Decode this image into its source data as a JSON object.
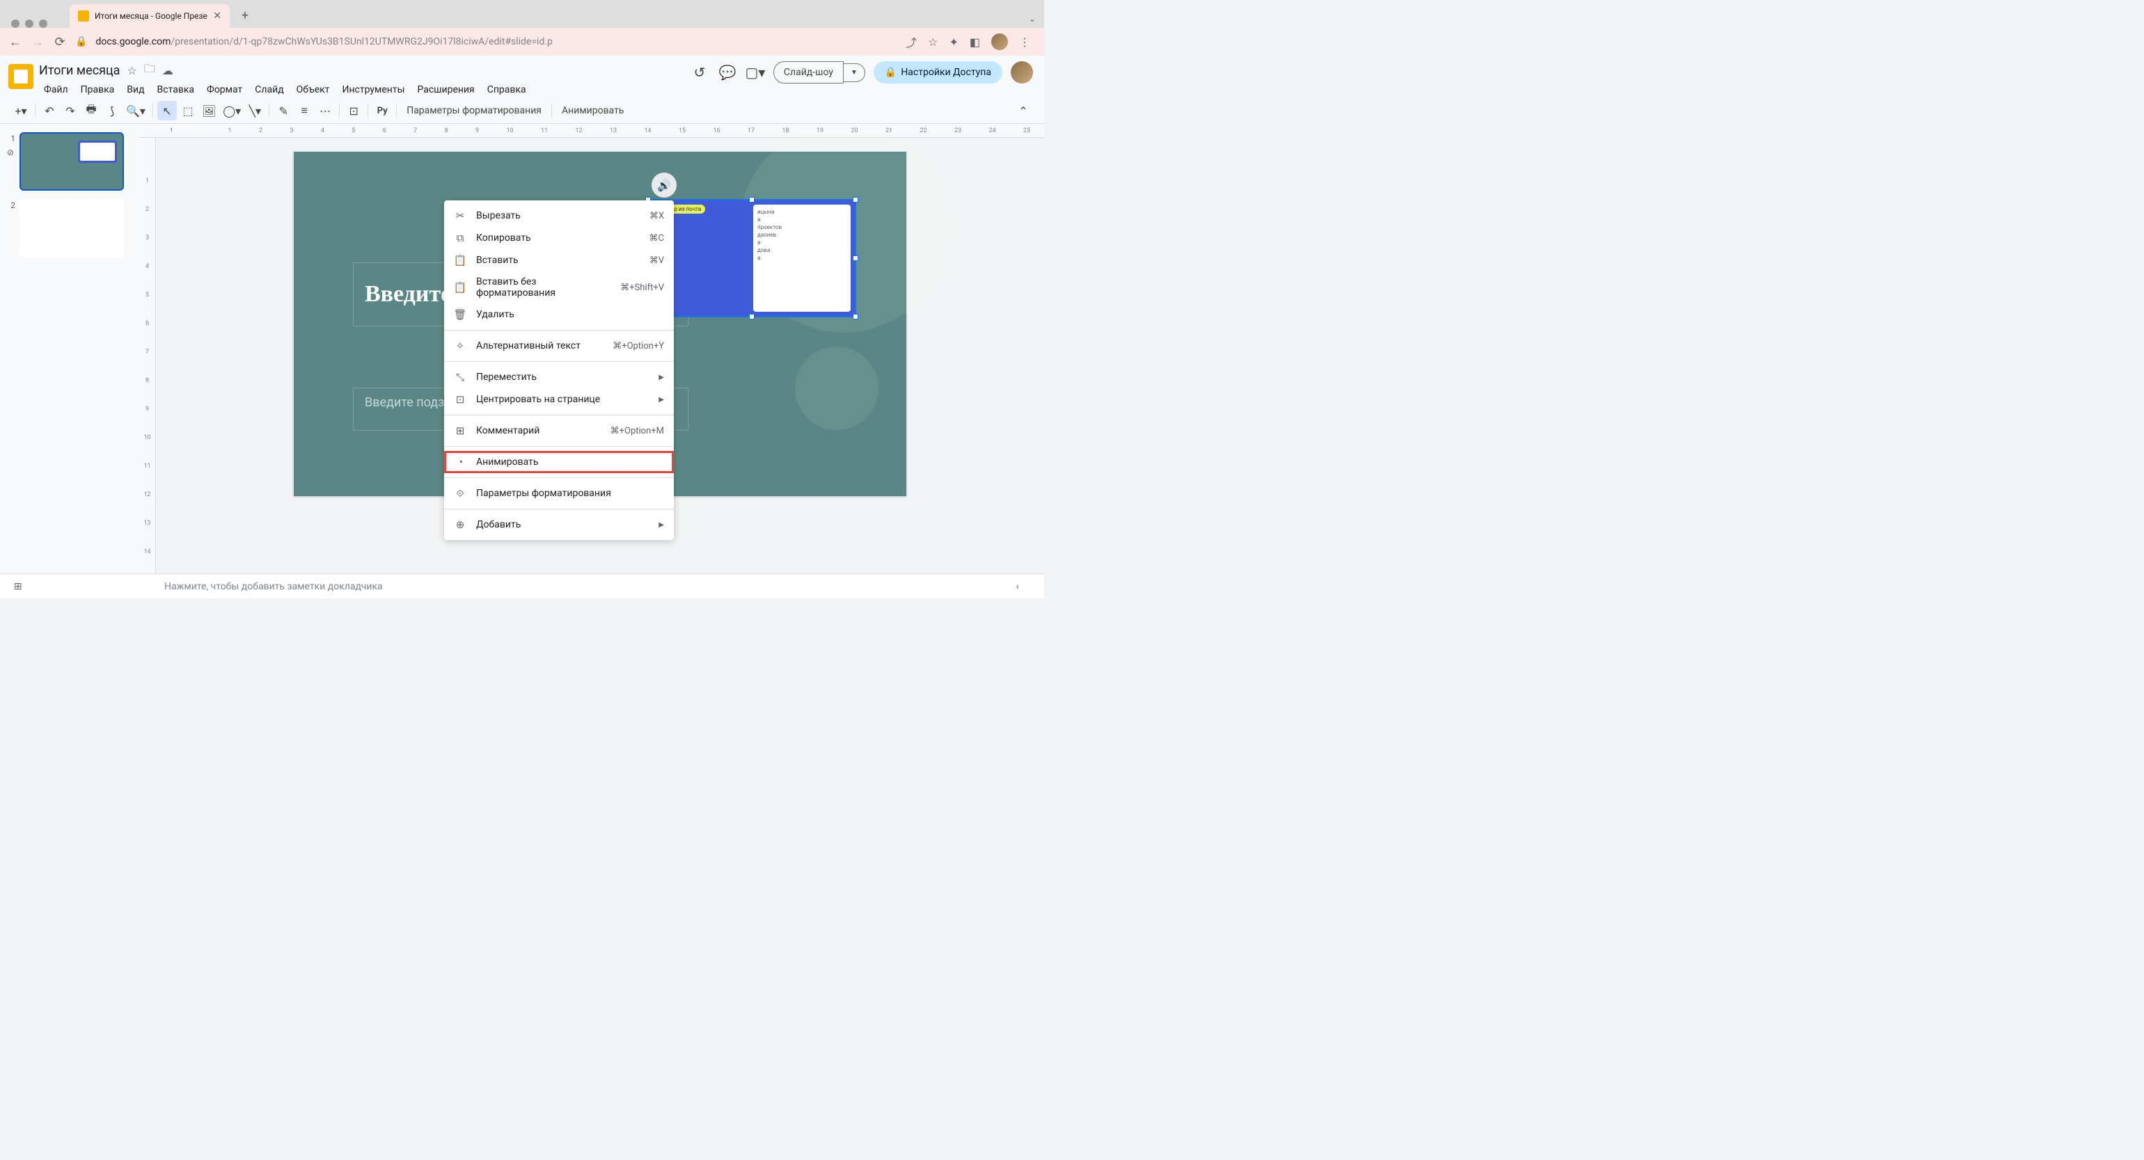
{
  "browser": {
    "tab_title": "Итоги месяца - Google Презе",
    "url_domain": "docs.google.com",
    "url_path": "/presentation/d/1-qp78zwChWsYUs3B1SUnl12UTMWRG2J9Oi17l8iciwA/edit#slide=id.p"
  },
  "doc": {
    "title": "Итоги месяца"
  },
  "menus": [
    "Файл",
    "Правка",
    "Вид",
    "Вставка",
    "Формат",
    "Слайд",
    "Объект",
    "Инструменты",
    "Расширения",
    "Справка"
  ],
  "header_buttons": {
    "slideshow": "Слайд-шоу",
    "share": "Настройки Доступа"
  },
  "toolbar": {
    "format_options": "Параметры форматирования",
    "animate": "Анимировать",
    "py": "Py"
  },
  "ruler_h": [
    "1",
    "",
    "1",
    "2",
    "3",
    "4",
    "5",
    "6",
    "7",
    "8",
    "9",
    "10",
    "11",
    "12",
    "13",
    "14",
    "15",
    "16",
    "17",
    "18",
    "19",
    "20",
    "21",
    "22",
    "23",
    "24",
    "25"
  ],
  "ruler_v": [
    "",
    "1",
    "2",
    "3",
    "4",
    "5",
    "6",
    "7",
    "8",
    "9",
    "10",
    "11",
    "12",
    "13",
    "14"
  ],
  "slides": [
    {
      "num": "1",
      "selected": true
    },
    {
      "num": "2",
      "selected": false
    }
  ],
  "slide_content": {
    "title_placeholder": "Введите заголово",
    "subtitle_placeholder": "Введите подзаголовок",
    "obj_pill": "оффер из почта",
    "obj_card_lines": [
      "ицына",
      "а",
      "проектов",
      "далиев",
      "а",
      "дова",
      "а"
    ]
  },
  "context_menu": [
    {
      "icon": "cut",
      "label": "Вырезать",
      "shortcut": "⌘X"
    },
    {
      "icon": "copy",
      "label": "Копировать",
      "shortcut": "⌘C"
    },
    {
      "icon": "paste",
      "label": "Вставить",
      "shortcut": "⌘V"
    },
    {
      "icon": "paste-special",
      "label": "Вставить без форматирования",
      "shortcut": "⌘+Shift+V"
    },
    {
      "icon": "delete",
      "label": "Удалить",
      "shortcut": ""
    },
    {
      "sep": true
    },
    {
      "icon": "alt-text",
      "label": "Альтернативный текст",
      "shortcut": "⌘+Option+Y"
    },
    {
      "sep": true
    },
    {
      "icon": "move",
      "label": "Переместить",
      "arrow": true
    },
    {
      "icon": "center",
      "label": "Центрировать на странице",
      "arrow": true
    },
    {
      "sep": true
    },
    {
      "icon": "comment",
      "label": "Комментарий",
      "shortcut": "⌘+Option+M"
    },
    {
      "sep": true
    },
    {
      "icon": "animate",
      "label": "Анимировать",
      "highlighted": true
    },
    {
      "sep": true
    },
    {
      "icon": "format",
      "label": "Параметры форматирования"
    },
    {
      "sep": true
    },
    {
      "icon": "add",
      "label": "Добавить",
      "arrow": true
    }
  ],
  "notes": {
    "placeholder": "Нажмите, чтобы добавить заметки докладчика"
  }
}
